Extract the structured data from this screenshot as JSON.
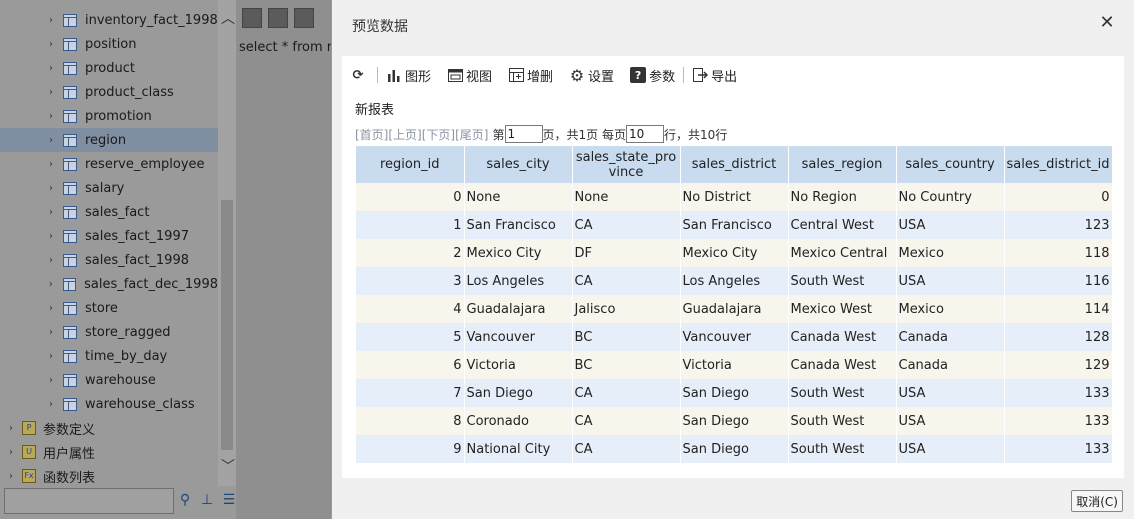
{
  "tree": {
    "items": [
      {
        "label": "inventory_fact_1998",
        "kind": "table"
      },
      {
        "label": "position",
        "kind": "table"
      },
      {
        "label": "product",
        "kind": "table"
      },
      {
        "label": "product_class",
        "kind": "table"
      },
      {
        "label": "promotion",
        "kind": "table"
      },
      {
        "label": "region",
        "kind": "table",
        "selected": true
      },
      {
        "label": "reserve_employee",
        "kind": "table"
      },
      {
        "label": "salary",
        "kind": "table"
      },
      {
        "label": "sales_fact",
        "kind": "table"
      },
      {
        "label": "sales_fact_1997",
        "kind": "table"
      },
      {
        "label": "sales_fact_1998",
        "kind": "table"
      },
      {
        "label": "sales_fact_dec_1998",
        "kind": "table"
      },
      {
        "label": "store",
        "kind": "table"
      },
      {
        "label": "store_ragged",
        "kind": "table"
      },
      {
        "label": "time_by_day",
        "kind": "table"
      },
      {
        "label": "warehouse",
        "kind": "table"
      },
      {
        "label": "warehouse_class",
        "kind": "table"
      }
    ],
    "folders": [
      {
        "label": "参数定义",
        "icon": "P"
      },
      {
        "label": "用户属性",
        "icon": "U"
      },
      {
        "label": "函数列表",
        "icon": "Fx"
      }
    ],
    "search_value": ""
  },
  "editor": {
    "sql": "select * from  re"
  },
  "dialog": {
    "title": "预览数据",
    "close_glyph": "✕",
    "toolbar": {
      "refresh_glyph": "⟳",
      "chart": "图形",
      "view": "视图",
      "add_delete": "增删",
      "settings": "设置",
      "params": "参数",
      "export": "导出"
    },
    "report_name": "新报表",
    "pager": {
      "first": "[首页]",
      "prev": "[上页]",
      "next": "[下页]",
      "last": "[尾页]",
      "page_prefix": "第",
      "page_value": "1",
      "page_suffix": "页，共1页 每页",
      "size_value": "10",
      "size_suffix": "行，共10行"
    },
    "cancel_label": "取消(C)"
  },
  "grid": {
    "columns": [
      "region_id",
      "sales_city",
      "sales_state_province",
      "sales_district",
      "sales_region",
      "sales_country",
      "sales_district_id"
    ],
    "rows": [
      [
        "0",
        "None",
        "None",
        "No District",
        "No Region",
        "No Country",
        "0"
      ],
      [
        "1",
        "San Francisco",
        "CA",
        "San Francisco",
        "Central West",
        "USA",
        "123"
      ],
      [
        "2",
        "Mexico City",
        "DF",
        "Mexico City",
        "Mexico Central",
        "Mexico",
        "118"
      ],
      [
        "3",
        "Los Angeles",
        "CA",
        "Los Angeles",
        "South West",
        "USA",
        "116"
      ],
      [
        "4",
        "Guadalajara",
        "Jalisco",
        "Guadalajara",
        "Mexico West",
        "Mexico",
        "114"
      ],
      [
        "5",
        "Vancouver",
        "BC",
        "Vancouver",
        "Canada West",
        "Canada",
        "128"
      ],
      [
        "6",
        "Victoria",
        "BC",
        "Victoria",
        "Canada West",
        "Canada",
        "129"
      ],
      [
        "7",
        "San Diego",
        "CA",
        "San Diego",
        "South West",
        "USA",
        "133"
      ],
      [
        "8",
        "Coronado",
        "CA",
        "San Diego",
        "South West",
        "USA",
        "133"
      ],
      [
        "9",
        "National City",
        "CA",
        "San Diego",
        "South West",
        "USA",
        "133"
      ]
    ]
  }
}
